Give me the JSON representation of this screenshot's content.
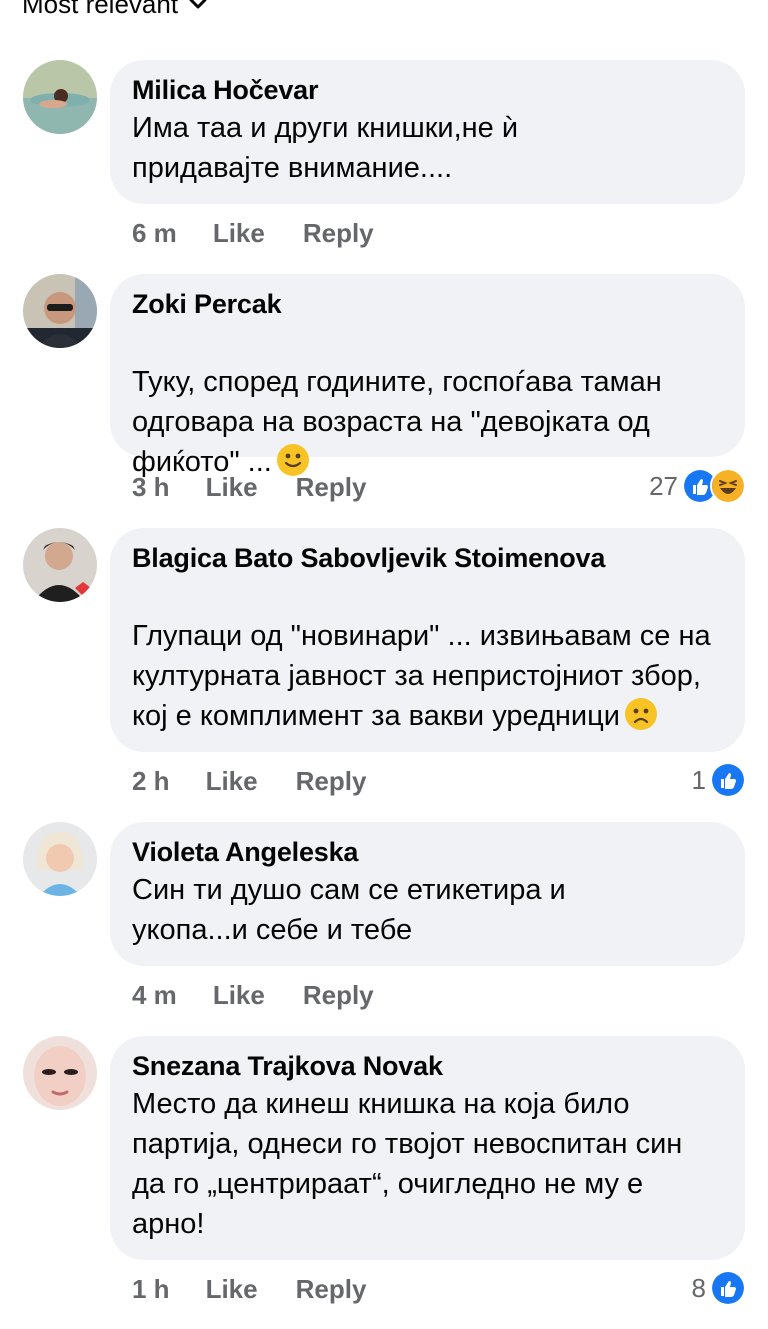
{
  "sort": {
    "label": "Most relevant",
    "icon": "chevron-down-icon"
  },
  "colors": {
    "bubble": "#f0f2f5",
    "meta_text": "#65676b",
    "like_blue": "#1877f2",
    "haha_yellow": "#f7b125"
  },
  "comments": [
    {
      "author": "Milica Hočevar",
      "text": "Има таа и други книшки,не ѝ придавајте внимание....",
      "time": "6 m",
      "like": "Like",
      "reply": "Reply",
      "reaction_count": ""
    },
    {
      "author": "Zoki Percak",
      "text": "Туку, според годините, госпоѓава таман одговара на возраста на \"девојката од фиќото\" ...",
      "emoji": "slightly-smiling-face-icon",
      "time": "3 h",
      "like": "Like",
      "reply": "Reply",
      "reaction_count": "27",
      "reactions": [
        "like-reaction-icon",
        "haha-reaction-icon"
      ]
    },
    {
      "author": "Blagica Bato Sabovljevik Stoimenova",
      "text": "Глупаци од \"новинари\" ... извињавам се на културната јавност за непристојниот збор, кој е комплимент за вакви уредници",
      "emoji": "frowning-face-icon",
      "time": "2 h",
      "like": "Like",
      "reply": "Reply",
      "reaction_count": "1",
      "reactions": [
        "like-reaction-icon"
      ]
    },
    {
      "author": "Violeta Angeleska",
      "text": "Син ти душо сам се етикетира и укопа...и себе и тебе",
      "time": "4 m",
      "like": "Like",
      "reply": "Reply",
      "reaction_count": ""
    },
    {
      "author": "Snezana Trajkova Novak",
      "text": "Место да кинеш книшка на која било партија, однеси го твојот невоспитан син да го „центрираат“, очигледно не му е арно!",
      "time": "1 h",
      "like": "Like",
      "reply": "Reply",
      "reaction_count": "8",
      "reactions": [
        "like-reaction-icon"
      ]
    }
  ]
}
